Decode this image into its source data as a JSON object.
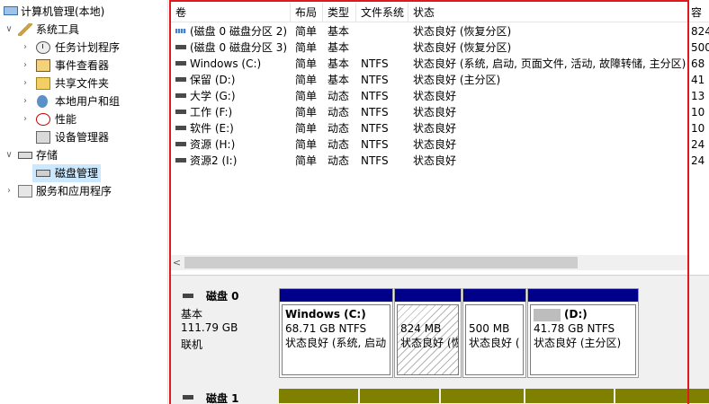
{
  "tree": {
    "root": "计算机管理(本地)",
    "system_tools": "系统工具",
    "task_scheduler": "任务计划程序",
    "event_viewer": "事件查看器",
    "shared_folders": "共享文件夹",
    "local_users": "本地用户和组",
    "performance": "性能",
    "device_manager": "设备管理器",
    "storage": "存储",
    "disk_management": "磁盘管理",
    "services_apps": "服务和应用程序"
  },
  "volume_table": {
    "columns": [
      "卷",
      "布局",
      "类型",
      "文件系统",
      "状态",
      "容"
    ],
    "rows": [
      {
        "volume": "(磁盘 0 磁盘分区 2)",
        "layout": "简单",
        "type": "基本",
        "fs": "",
        "status": "状态良好 (恢复分区)",
        "cap": "824",
        "icon": "recovery"
      },
      {
        "volume": "(磁盘 0 磁盘分区 3)",
        "layout": "简单",
        "type": "基本",
        "fs": "",
        "status": "状态良好 (恢复分区)",
        "cap": "500",
        "icon": "normal"
      },
      {
        "volume": "Windows (C:)",
        "layout": "简单",
        "type": "基本",
        "fs": "NTFS",
        "status": "状态良好 (系统, 启动, 页面文件, 活动, 故障转储, 主分区)",
        "cap": "68",
        "icon": "normal"
      },
      {
        "volume": "保留 (D:)",
        "layout": "简单",
        "type": "基本",
        "fs": "NTFS",
        "status": "状态良好 (主分区)",
        "cap": "41",
        "icon": "normal"
      },
      {
        "volume": "大学 (G:)",
        "layout": "简单",
        "type": "动态",
        "fs": "NTFS",
        "status": "状态良好",
        "cap": "13",
        "icon": "normal"
      },
      {
        "volume": "工作 (F:)",
        "layout": "简单",
        "type": "动态",
        "fs": "NTFS",
        "status": "状态良好",
        "cap": "10",
        "icon": "normal"
      },
      {
        "volume": "软件 (E:)",
        "layout": "简单",
        "type": "动态",
        "fs": "NTFS",
        "status": "状态良好",
        "cap": "10",
        "icon": "normal"
      },
      {
        "volume": "资源 (H:)",
        "layout": "简单",
        "type": "动态",
        "fs": "NTFS",
        "status": "状态良好",
        "cap": "24",
        "icon": "normal"
      },
      {
        "volume": "资源2 (I:)",
        "layout": "简单",
        "type": "动态",
        "fs": "NTFS",
        "status": "状态良好",
        "cap": "24",
        "icon": "normal"
      }
    ]
  },
  "scroll": {
    "left_arrow": "<"
  },
  "disk0": {
    "name": "磁盘 0",
    "kind": "基本",
    "size": "111.79 GB",
    "state": "联机",
    "partitions": [
      {
        "title": "Windows  (C:)",
        "line1": "68.71 GB NTFS",
        "line2": "状态良好 (系统, 启动"
      },
      {
        "title": "",
        "line1": "824 MB",
        "line2": "状态良好 (恢"
      },
      {
        "title": "",
        "line1": "500 MB",
        "line2": "状态良好 ("
      },
      {
        "title": "(D:)",
        "line1": "41.78 GB NTFS",
        "line2": "状态良好 (主分区)"
      }
    ]
  },
  "disk1": {
    "name": "磁盘 1"
  },
  "colors": {
    "primary_bar": "#00008B",
    "dynamic_bar": "#808000",
    "highlight_frame": "#E0191F",
    "selection": "#CCE8FF"
  }
}
